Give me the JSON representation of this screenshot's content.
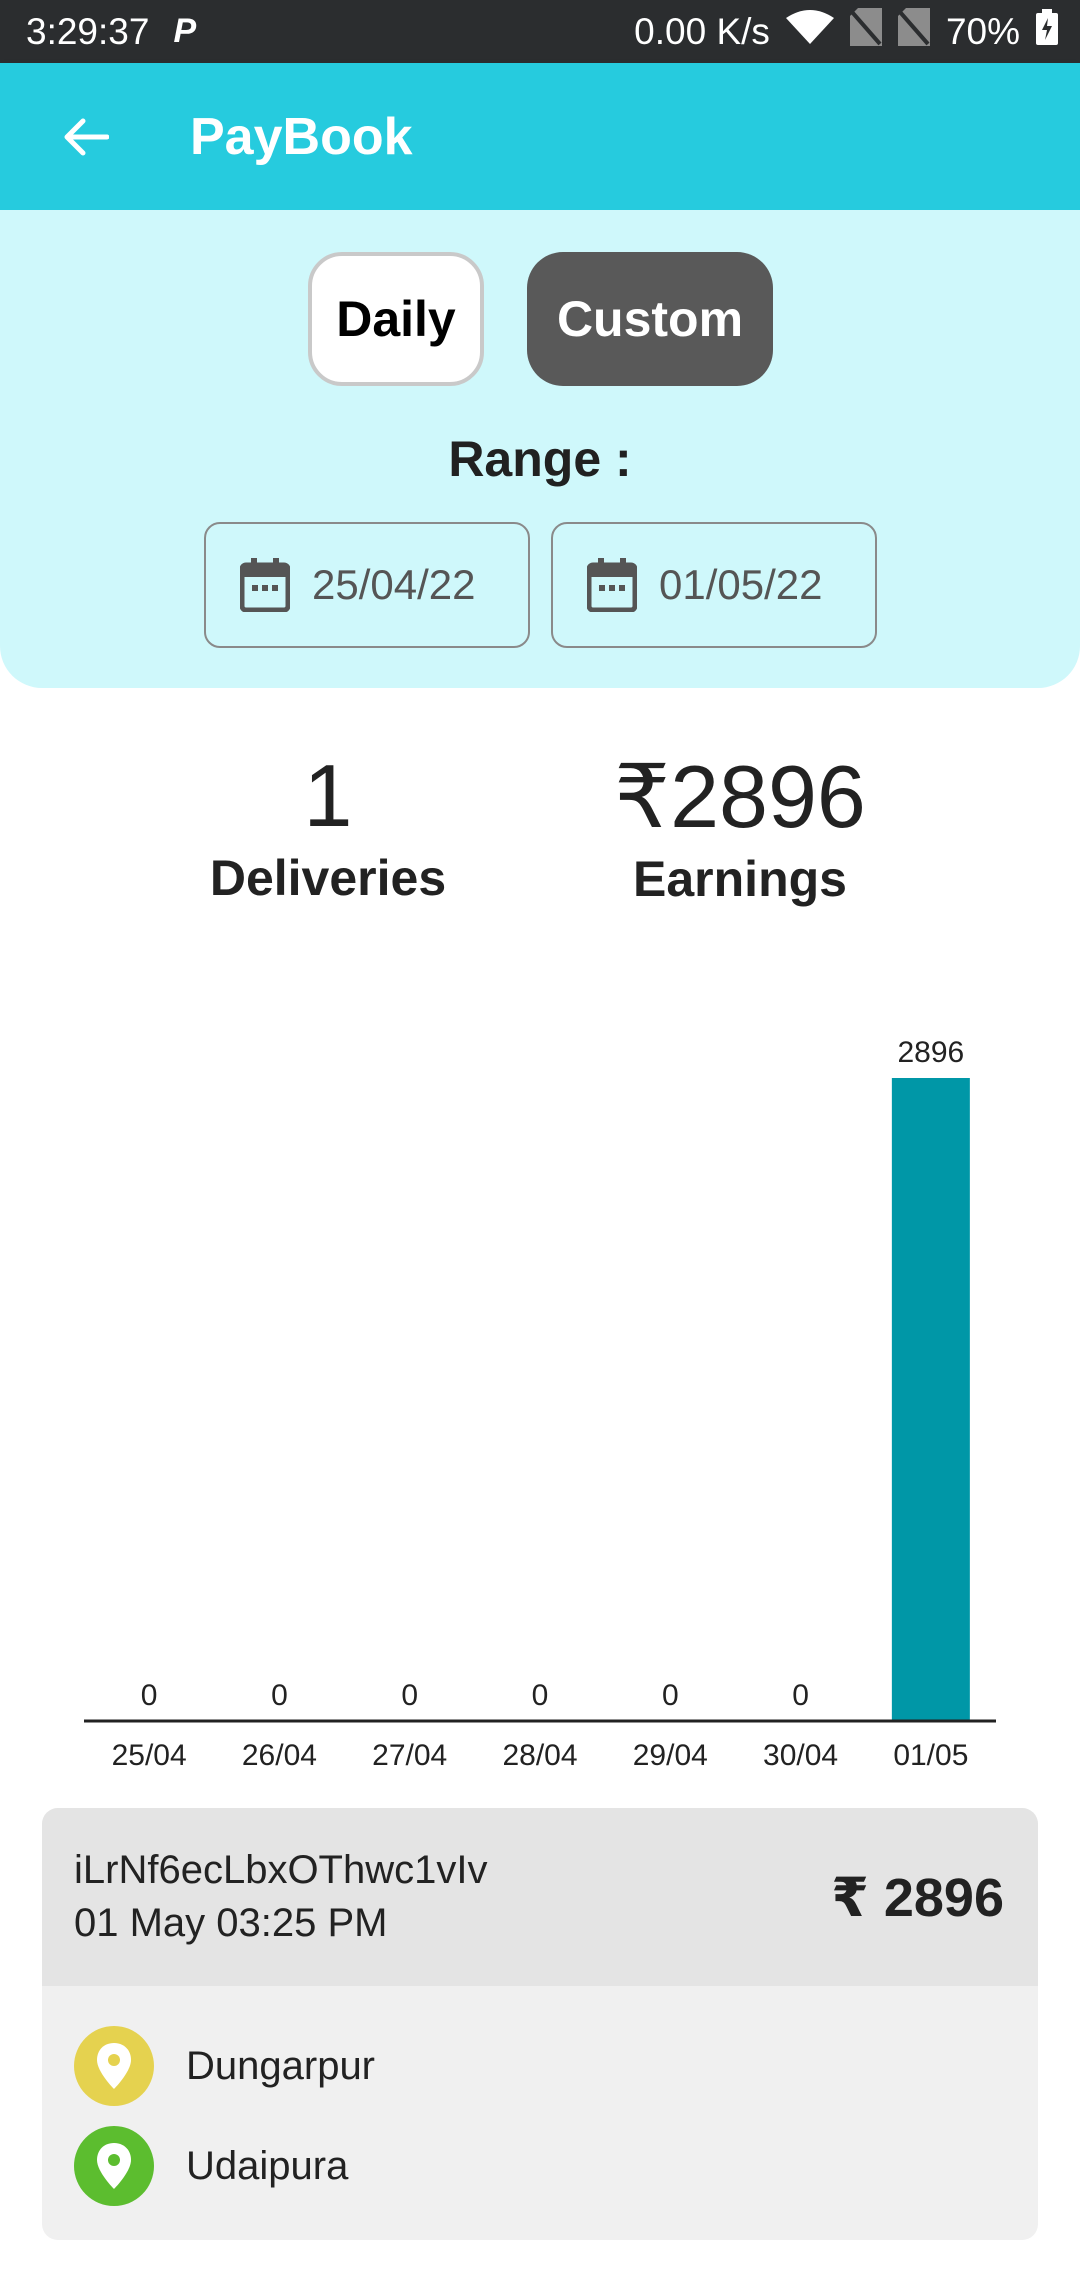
{
  "status_bar": {
    "time": "3:29:37",
    "app_badge": "P",
    "net_speed": "0.00 K/s",
    "battery": "70%"
  },
  "app_bar": {
    "title": "PayBook",
    "back_icon": "arrow-left-icon"
  },
  "filter": {
    "daily_label": "Daily",
    "custom_label": "Custom",
    "selected": "Custom",
    "range_label": "Range :",
    "start_date": "25/04/22",
    "end_date": "01/05/22",
    "date_icon": "calendar-icon"
  },
  "summary": {
    "deliveries_value": "1",
    "deliveries_label": "Deliveries",
    "earnings_value": "₹2896",
    "earnings_label": "Earnings"
  },
  "chart_data": {
    "type": "bar",
    "categories": [
      "25/04",
      "26/04",
      "27/04",
      "28/04",
      "29/04",
      "30/04",
      "01/05"
    ],
    "values": [
      0,
      0,
      0,
      0,
      0,
      0,
      2896
    ],
    "data_labels": [
      "0",
      "0",
      "0",
      "0",
      "0",
      "0",
      "2896"
    ],
    "title": "",
    "xlabel": "",
    "ylabel": "",
    "ylim": [
      0,
      2896
    ],
    "grid": false,
    "bar_color": "#0097a7"
  },
  "transaction": {
    "id": "iLrNf6ecLbxOThwc1vIv",
    "datetime": "01 May 03:25 PM",
    "amount": "₹ 2896",
    "pickup": "Dungarpur",
    "drop": "Udaipura"
  },
  "colors": {
    "app_bar": "#26cbde",
    "panel": "#cff8fb",
    "bar": "#0097a7",
    "pickup_pin": "#e5d24f",
    "drop_pin": "#5cbd2f"
  }
}
